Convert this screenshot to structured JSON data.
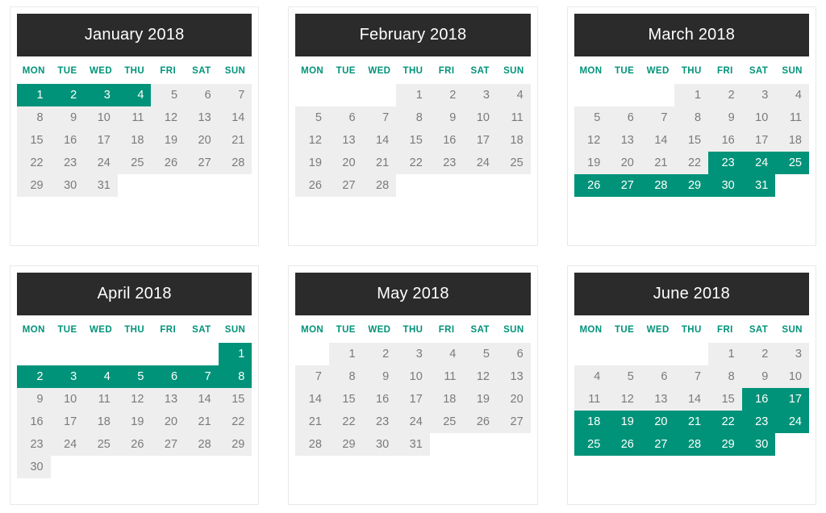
{
  "theme": {
    "page_background": "#ffffff",
    "card_border": "#e9e9e9",
    "header_background": "#2b2b2b",
    "header_text": "#ffffff",
    "weekday_text": "#009379",
    "day_background": "#eeeeee",
    "day_text": "#7a7a7a",
    "highlight_background": "#009379",
    "highlight_text": "#ffffff"
  },
  "weekdays": [
    "MON",
    "TUE",
    "WED",
    "THU",
    "FRI",
    "SAT",
    "SUN"
  ],
  "months": [
    {
      "title": "January 2018",
      "start_weekday_index": 0,
      "days_in_month": 31,
      "highlighted_days": [
        1,
        2,
        3,
        4
      ],
      "weeks": [
        [
          "",
          "",
          "",
          "",
          "",
          "",
          ""
        ],
        [
          "1",
          "2",
          "3",
          "4",
          "5",
          "6",
          "7"
        ],
        [
          "8",
          "9",
          "10",
          "11",
          "12",
          "13",
          "14"
        ],
        [
          "15",
          "16",
          "17",
          "18",
          "19",
          "20",
          "21"
        ],
        [
          "22",
          "23",
          "24",
          "25",
          "26",
          "27",
          "28"
        ],
        [
          "29",
          "30",
          "31",
          "",
          "",
          "",
          ""
        ]
      ]
    },
    {
      "title": "February 2018",
      "start_weekday_index": 3,
      "days_in_month": 28,
      "highlighted_days": [],
      "weeks": [
        [
          "",
          "",
          "",
          "1",
          "2",
          "3",
          "4"
        ],
        [
          "5",
          "6",
          "7",
          "8",
          "9",
          "10",
          "11"
        ],
        [
          "12",
          "13",
          "14",
          "15",
          "16",
          "17",
          "18"
        ],
        [
          "19",
          "20",
          "21",
          "22",
          "23",
          "24",
          "25"
        ],
        [
          "26",
          "27",
          "28",
          "",
          "",
          "",
          ""
        ]
      ]
    },
    {
      "title": "March 2018",
      "start_weekday_index": 3,
      "days_in_month": 31,
      "highlighted_days": [
        23,
        24,
        25,
        26,
        27,
        28,
        29,
        30,
        31
      ],
      "weeks": [
        [
          "",
          "",
          "",
          "1",
          "2",
          "3",
          "4"
        ],
        [
          "5",
          "6",
          "7",
          "8",
          "9",
          "10",
          "11"
        ],
        [
          "12",
          "13",
          "14",
          "15",
          "16",
          "17",
          "18"
        ],
        [
          "19",
          "20",
          "21",
          "22",
          "23",
          "24",
          "25"
        ],
        [
          "26",
          "27",
          "28",
          "29",
          "30",
          "31",
          ""
        ]
      ]
    },
    {
      "title": "April 2018",
      "start_weekday_index": 6,
      "days_in_month": 30,
      "highlighted_days": [
        1,
        2,
        3,
        4,
        5,
        6,
        7,
        8
      ],
      "weeks": [
        [
          "",
          "",
          "",
          "",
          "",
          "",
          "1"
        ],
        [
          "2",
          "3",
          "4",
          "5",
          "6",
          "7",
          "8"
        ],
        [
          "9",
          "10",
          "11",
          "12",
          "13",
          "14",
          "15"
        ],
        [
          "16",
          "17",
          "18",
          "19",
          "20",
          "21",
          "22"
        ],
        [
          "23",
          "24",
          "25",
          "26",
          "27",
          "28",
          "29"
        ],
        [
          "30",
          "",
          "",
          "",
          "",
          "",
          ""
        ]
      ]
    },
    {
      "title": "May 2018",
      "start_weekday_index": 1,
      "days_in_month": 31,
      "highlighted_days": [],
      "weeks": [
        [
          "",
          "1",
          "2",
          "3",
          "4",
          "5",
          "6"
        ],
        [
          "7",
          "8",
          "9",
          "10",
          "11",
          "12",
          "13"
        ],
        [
          "14",
          "15",
          "16",
          "17",
          "18",
          "19",
          "20"
        ],
        [
          "21",
          "22",
          "23",
          "24",
          "25",
          "26",
          "27"
        ],
        [
          "28",
          "29",
          "30",
          "31",
          "",
          "",
          ""
        ]
      ]
    },
    {
      "title": "June 2018",
      "start_weekday_index": 4,
      "days_in_month": 30,
      "highlighted_days": [
        16,
        17,
        18,
        19,
        20,
        21,
        22,
        23,
        24,
        25,
        26,
        27,
        28,
        29,
        30
      ],
      "weeks": [
        [
          "",
          "",
          "",
          "",
          "1",
          "2",
          "3"
        ],
        [
          "4",
          "5",
          "6",
          "7",
          "8",
          "9",
          "10"
        ],
        [
          "11",
          "12",
          "13",
          "14",
          "15",
          "16",
          "17"
        ],
        [
          "18",
          "19",
          "20",
          "21",
          "22",
          "23",
          "24"
        ],
        [
          "25",
          "26",
          "27",
          "28",
          "29",
          "30",
          ""
        ]
      ]
    }
  ]
}
